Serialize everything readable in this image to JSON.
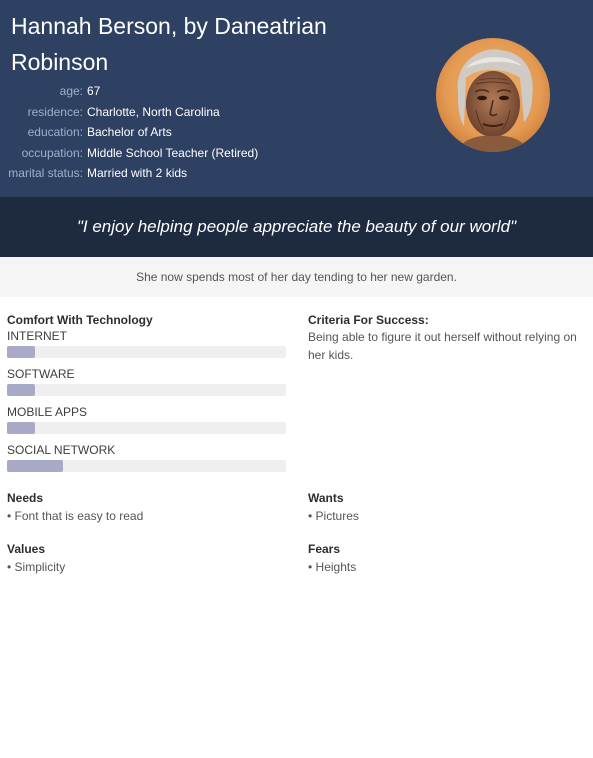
{
  "persona": {
    "name": "Hannah Berson, by Daneatrian Robinson",
    "facts": [
      {
        "label": "age:",
        "value": "67"
      },
      {
        "label": "residence:",
        "value": "Charlotte, North Carolina"
      },
      {
        "label": "education:",
        "value": "Bachelor of Arts"
      },
      {
        "label": "occupation:",
        "value": "Middle School Teacher (Retired)"
      },
      {
        "label": "marital status:",
        "value": "Married with 2 kids"
      }
    ],
    "photo_icon": "portrait-photo"
  },
  "quote": "\"I enjoy helping people appreciate the beauty of our world\"",
  "bio": "She now spends most of her day tending to her new garden.",
  "comfort": {
    "title": "Comfort With Technology",
    "items": [
      {
        "label": "INTERNET",
        "level": 0.1
      },
      {
        "label": "SOFTWARE",
        "level": 0.1
      },
      {
        "label": "MOBILE APPS",
        "level": 0.1
      },
      {
        "label": "SOCIAL NETWORK",
        "level": 0.2
      }
    ],
    "bar_color": "#a8a9c6"
  },
  "criteria": {
    "title": "Criteria For Success:",
    "text": "Being able to figure it out herself without relying on her kids."
  },
  "needs": {
    "title": "Needs",
    "items": [
      "Font that is easy to read"
    ]
  },
  "wants": {
    "title": "Wants",
    "items": [
      "Pictures"
    ]
  },
  "values": {
    "title": "Values",
    "items": [
      "Simplicity"
    ]
  },
  "fears": {
    "title": "Fears",
    "items": [
      "Heights"
    ]
  },
  "colors": {
    "header": "#2e4163",
    "quote_bar": "#1d2a40",
    "bio_bar": "#f5f5f6"
  }
}
